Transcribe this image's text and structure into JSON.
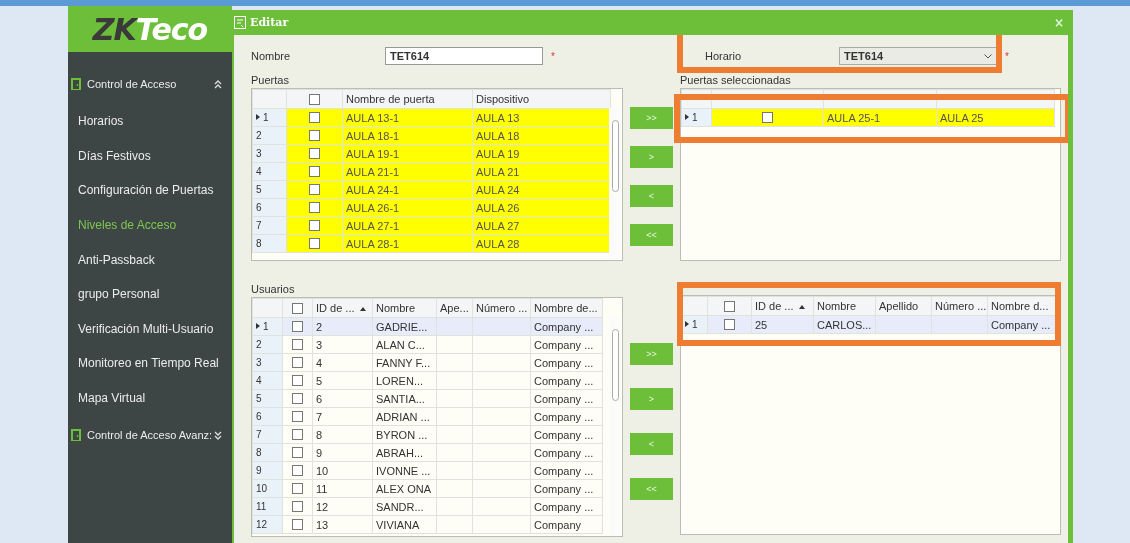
{
  "sidebar": {
    "logo": {
      "part_1": "ZK",
      "part_2": "Teco"
    },
    "items": [
      {
        "kind": "section",
        "label": "Control de Acceso",
        "expanded": true,
        "selected": false
      },
      {
        "kind": "link",
        "label": "Horarios",
        "selected": false
      },
      {
        "kind": "link",
        "label": "Días Festivos",
        "selected": false
      },
      {
        "kind": "link",
        "label": "Configuración de Puertas",
        "selected": false
      },
      {
        "kind": "link",
        "label": "Niveles de Acceso",
        "selected": true
      },
      {
        "kind": "link",
        "label": "Anti-Passback",
        "selected": false
      },
      {
        "kind": "link",
        "label": "grupo Personal",
        "selected": false
      },
      {
        "kind": "link",
        "label": "Verificación Multi-Usuario",
        "selected": false
      },
      {
        "kind": "link",
        "label": "Monitoreo en Tiempo Real",
        "selected": false
      },
      {
        "kind": "link",
        "label": "Mapa Virtual",
        "selected": false
      },
      {
        "kind": "section",
        "label": "Control de Acceso Avanz:",
        "expanded": false,
        "selected": false
      }
    ]
  },
  "dialog": {
    "title": "Editar",
    "close": "×",
    "name_field": {
      "label": "Nombre",
      "value": "TET614",
      "required_mark": "*"
    },
    "schedule_field": {
      "label": "Horario",
      "value": "TET614",
      "required_mark": "*",
      "highlighted": true
    },
    "doors": {
      "label": "Puertas",
      "header_checked": false,
      "columns": [
        {
          "label": "Nombre de puerta"
        },
        {
          "label": "Dispositivo"
        }
      ],
      "rows": [
        {
          "index": "1",
          "current": true,
          "checked": false,
          "highlighted": true,
          "cells": [
            "AULA 13-1",
            "AULA 13"
          ]
        },
        {
          "index": "2",
          "current": false,
          "checked": false,
          "highlighted": true,
          "cells": [
            "AULA 18-1",
            "AULA 18"
          ]
        },
        {
          "index": "3",
          "current": false,
          "checked": false,
          "highlighted": true,
          "cells": [
            "AULA 19-1",
            "AULA 19"
          ]
        },
        {
          "index": "4",
          "current": false,
          "checked": false,
          "highlighted": true,
          "cells": [
            "AULA 21-1",
            "AULA 21"
          ]
        },
        {
          "index": "5",
          "current": false,
          "checked": false,
          "highlighted": true,
          "cells": [
            "AULA 24-1",
            "AULA 24"
          ]
        },
        {
          "index": "6",
          "current": false,
          "checked": false,
          "highlighted": true,
          "cells": [
            "AULA 26-1",
            "AULA 26"
          ]
        },
        {
          "index": "7",
          "current": false,
          "checked": false,
          "highlighted": true,
          "cells": [
            "AULA 27-1",
            "AULA 27"
          ]
        },
        {
          "index": "8",
          "current": false,
          "checked": false,
          "highlighted": true,
          "cells": [
            "AULA 28-1",
            "AULA 28"
          ]
        }
      ]
    },
    "door_buttons": [
      ">>",
      ">",
      "<",
      "<<"
    ],
    "selected_doors": {
      "highlighted": true,
      "label": "Puertas seleccionadas",
      "rows": [
        {
          "index": "1",
          "current": true,
          "checked": false,
          "highlighted": true,
          "cells": [
            "AULA 25-1",
            "AULA 25"
          ]
        }
      ]
    },
    "users": {
      "label": "Usuarios",
      "header_checked": false,
      "columns": [
        {
          "label": "ID de ...",
          "sorted": true
        },
        {
          "label": "Nombre"
        },
        {
          "label": "Ape..."
        },
        {
          "label": "Número ..."
        },
        {
          "label": "Nombre de..."
        }
      ],
      "rows": [
        {
          "index": "1",
          "current": true,
          "checked": false,
          "highlighted": false,
          "cells": [
            "2",
            "GADRIE...",
            "",
            "",
            "Company ..."
          ]
        },
        {
          "index": "2",
          "current": false,
          "checked": false,
          "highlighted": false,
          "cells": [
            "3",
            "ALAN C...",
            "",
            "",
            "Company ..."
          ]
        },
        {
          "index": "3",
          "current": false,
          "checked": false,
          "highlighted": false,
          "cells": [
            "4",
            "FANNY F...",
            "",
            "",
            "Company ..."
          ]
        },
        {
          "index": "4",
          "current": false,
          "checked": false,
          "highlighted": false,
          "cells": [
            "5",
            "LOREN...",
            "",
            "",
            "Company ..."
          ]
        },
        {
          "index": "5",
          "current": false,
          "checked": false,
          "highlighted": false,
          "cells": [
            "6",
            "SANTIA...",
            "",
            "",
            "Company ..."
          ]
        },
        {
          "index": "6",
          "current": false,
          "checked": false,
          "highlighted": false,
          "cells": [
            "7",
            "ADRIAN ...",
            "",
            "",
            "Company ..."
          ]
        },
        {
          "index": "7",
          "current": false,
          "checked": false,
          "highlighted": false,
          "cells": [
            "8",
            "BYRON ...",
            "",
            "",
            "Company ..."
          ]
        },
        {
          "index": "8",
          "current": false,
          "checked": false,
          "highlighted": false,
          "cells": [
            "9",
            "ABRAH...",
            "",
            "",
            "Company ..."
          ]
        },
        {
          "index": "9",
          "current": false,
          "checked": false,
          "highlighted": false,
          "cells": [
            "10",
            "IVONNE ...",
            "",
            "",
            "Company ..."
          ]
        },
        {
          "index": "10",
          "current": false,
          "checked": false,
          "highlighted": false,
          "cells": [
            "11",
            "ALEX ONA",
            "",
            "",
            "Company ..."
          ]
        },
        {
          "index": "11",
          "current": false,
          "checked": false,
          "highlighted": false,
          "cells": [
            "12",
            "SANDR...",
            "",
            "",
            "Company ..."
          ]
        },
        {
          "index": "12",
          "current": false,
          "checked": false,
          "highlighted": false,
          "cells": [
            "13",
            "VIVIANA",
            "",
            "",
            "Company"
          ]
        }
      ]
    },
    "user_buttons": [
      ">>",
      ">",
      "<",
      "<<"
    ],
    "selected_users": {
      "highlighted": true,
      "header_checked": false,
      "columns": [
        {
          "label": "ID de ...",
          "sorted": true
        },
        {
          "label": "Nombre"
        },
        {
          "label": "Apellido"
        },
        {
          "label": "Número ..."
        },
        {
          "label": "Nombre d..."
        }
      ],
      "rows": [
        {
          "index": "1",
          "current": true,
          "checked": false,
          "highlighted": false,
          "cells": [
            "25",
            "CARLOS...",
            "",
            "",
            "Company ..."
          ]
        }
      ]
    }
  }
}
